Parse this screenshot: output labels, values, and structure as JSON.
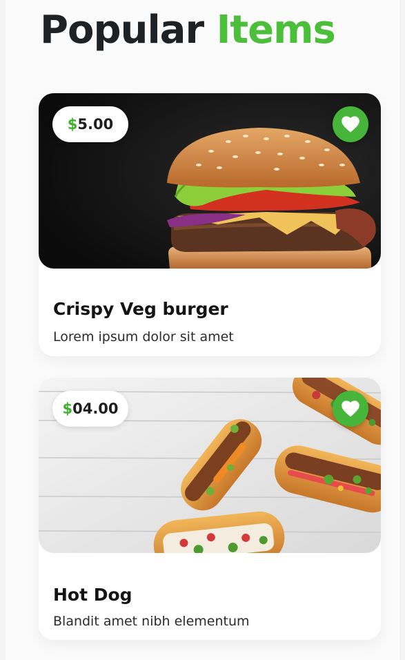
{
  "header": {
    "title_part1": "Popular",
    "title_part2": "Items"
  },
  "colors": {
    "accent": "#4bbe3a",
    "favorite_button": "#47b43a",
    "text_dark": "#1f2225"
  },
  "items": [
    {
      "price_symbol": "$",
      "price_value": "5.00",
      "name": "Crispy Veg burger",
      "description": "Lorem ipsum dolor sit amet",
      "image": "burger-photo",
      "favorite_icon": "heart-icon"
    },
    {
      "price_symbol": "$",
      "price_value": "04.00",
      "name": "Hot Dog",
      "description": "Blandit amet nibh elementum",
      "image": "hot-dog-photo",
      "favorite_icon": "heart-icon"
    }
  ]
}
